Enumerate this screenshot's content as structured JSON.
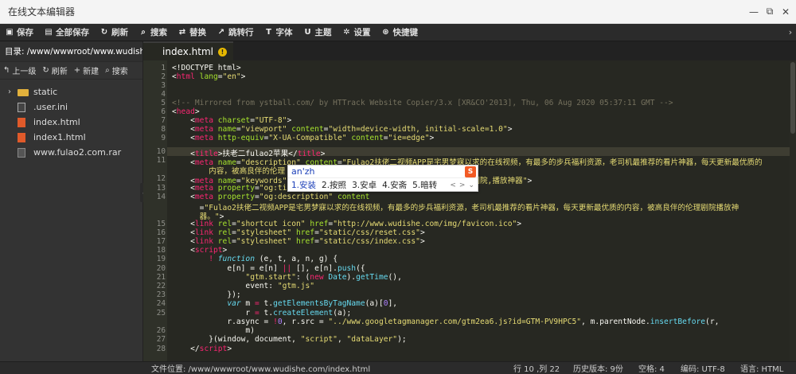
{
  "window": {
    "title": "在线文本编辑器"
  },
  "toolbar": {
    "items": [
      {
        "label": "保存",
        "icon": "save-icon",
        "glyph": "▣"
      },
      {
        "label": "全部保存",
        "icon": "save-all-icon",
        "glyph": "▤"
      },
      {
        "label": "刷新",
        "icon": "refresh-icon",
        "glyph": "↻"
      },
      {
        "label": "搜索",
        "icon": "search-icon",
        "glyph": "⌕"
      },
      {
        "label": "替换",
        "icon": "replace-icon",
        "glyph": "⇄"
      },
      {
        "label": "跳转行",
        "icon": "jump-icon",
        "glyph": "↗"
      },
      {
        "label": "字体",
        "icon": "font-icon",
        "glyph": "T"
      },
      {
        "label": "主题",
        "icon": "theme-icon",
        "glyph": "U"
      },
      {
        "label": "设置",
        "icon": "gear-icon",
        "glyph": "✲"
      },
      {
        "label": "快捷键",
        "icon": "shortcut-icon",
        "glyph": "⊛"
      }
    ]
  },
  "sidebar": {
    "path": "目录: /www/wwwroot/www.wudishe.c...",
    "actions": [
      {
        "label": "上一级",
        "glyph": "↰"
      },
      {
        "label": "刷新",
        "glyph": "↻"
      },
      {
        "label": "新建",
        "glyph": "+"
      },
      {
        "label": "搜索",
        "glyph": "⌕"
      }
    ],
    "tree": [
      {
        "label": "static",
        "type": "folder"
      },
      {
        "label": ".user.ini",
        "type": "file"
      },
      {
        "label": "index.html",
        "type": "html"
      },
      {
        "label": "index1.html",
        "type": "html"
      },
      {
        "label": "www.fulao2.com.rar",
        "type": "rar"
      }
    ]
  },
  "editor": {
    "tab": "index.html",
    "active_line": 10
  },
  "ime": {
    "input": "an'zh",
    "candidates": [
      "1.安装",
      "2.按照",
      "3.安卓",
      "4.安斋",
      "5.暗转"
    ],
    "prev": "<",
    "next": ">",
    "more": "⌄"
  },
  "status": {
    "path": "文件位置: /www/wwwroot/www.wudishe.com/index.html",
    "cursor": "行 10 ,列 22",
    "history": "历史版本: 9份",
    "indent": "空格: 4",
    "encoding": "编码: UTF-8",
    "language": "语言: HTML"
  },
  "colors": {
    "editor_bg": "#272822",
    "tag": "#f92672",
    "attr": "#a6e22e",
    "string": "#e6db74",
    "comment": "#75715e"
  }
}
